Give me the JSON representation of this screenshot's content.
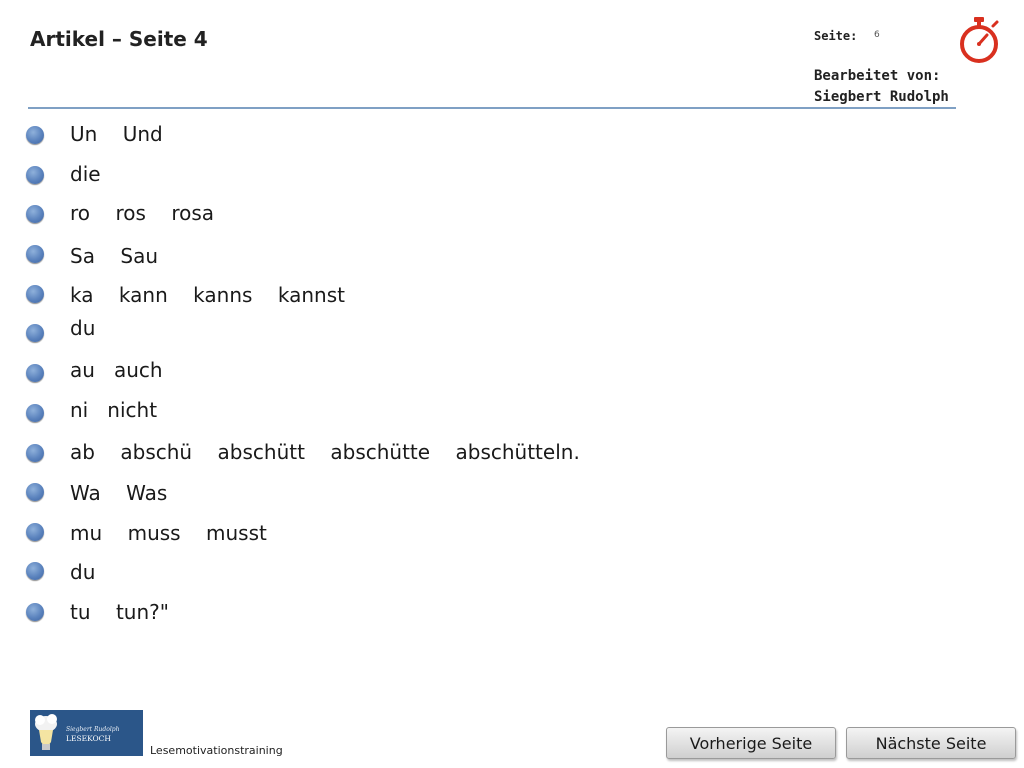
{
  "header": {
    "title": "Artikel – Seite 4",
    "seite_label": "Seite:",
    "seite_number": "6",
    "edited_by_label": "Bearbeitet von:",
    "editor_name": "Siegbert Rudolph",
    "timer_icon": "stopwatch-icon",
    "rule_color": "#7fa0c4"
  },
  "lines": [
    {
      "text": "Un    Und"
    },
    {
      "text": "die"
    },
    {
      "text": "ro    ros    rosa"
    },
    {
      "text": "Sa    Sau"
    },
    {
      "text": "ka    kann    kanns    kannst"
    },
    {
      "text": "du"
    },
    {
      "text": "au   auch"
    },
    {
      "text": "ni   nicht"
    },
    {
      "text": "ab    abschü    abschütt    abschütte    abschütteln."
    },
    {
      "text": "Wa    Was"
    },
    {
      "text": "mu    muss    musst"
    },
    {
      "text": "du"
    },
    {
      "text": "tu    tun?\""
    }
  ],
  "bullet_color": "#4a73b0",
  "footer": {
    "logo_text": "Siegbert Rudolph LESEKOCH",
    "caption": "Lesemotivationstraining",
    "prev_button": "Vorherige Seite",
    "next_button": "Nächste Seite"
  }
}
